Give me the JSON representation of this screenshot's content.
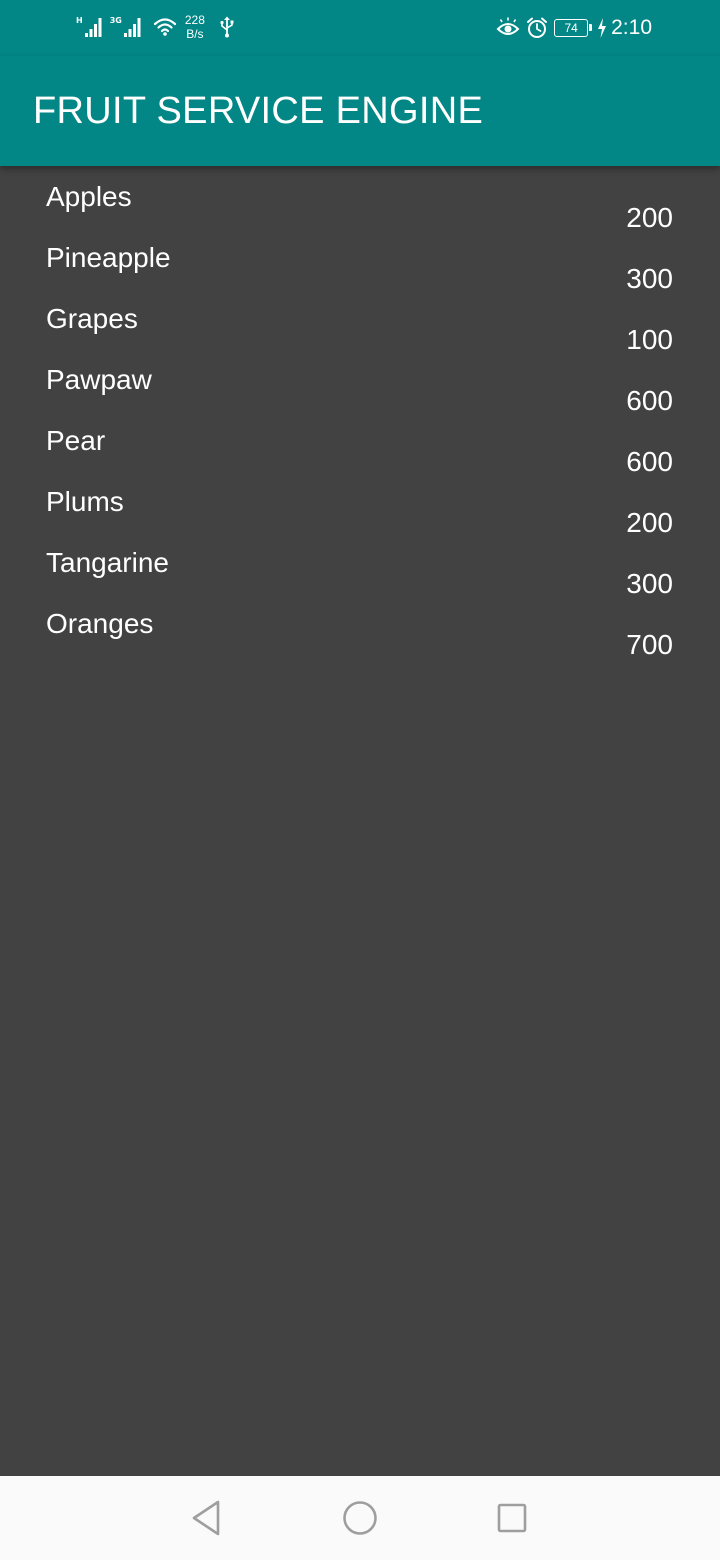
{
  "status_bar": {
    "network_1_tag": "H",
    "network_2_tag": "3G",
    "speed_value": "228",
    "speed_unit": "B/s",
    "battery_level": "74",
    "time": "2:10",
    "icons": [
      "signal-icon",
      "signal-icon",
      "wifi-icon",
      "usb-icon",
      "eye-icon",
      "alarm-icon",
      "battery-icon",
      "charging-icon"
    ]
  },
  "app_bar": {
    "title": "FRUIT SERVICE ENGINE"
  },
  "fruits": [
    {
      "name": "Apples",
      "price": "200"
    },
    {
      "name": "Pineapple",
      "price": "300"
    },
    {
      "name": "Grapes",
      "price": "100"
    },
    {
      "name": "Pawpaw",
      "price": "600"
    },
    {
      "name": "Pear",
      "price": "600"
    },
    {
      "name": "Plums",
      "price": "200"
    },
    {
      "name": "Tangarine",
      "price": "300"
    },
    {
      "name": "Oranges",
      "price": "700"
    }
  ],
  "nav_bar": {
    "icons": [
      "back-icon",
      "home-icon",
      "recents-icon"
    ]
  },
  "colors": {
    "primary": "#028786",
    "background": "#424242",
    "text": "#ffffff",
    "nav_background": "#fafafa",
    "nav_icon": "#9e9e9e"
  }
}
